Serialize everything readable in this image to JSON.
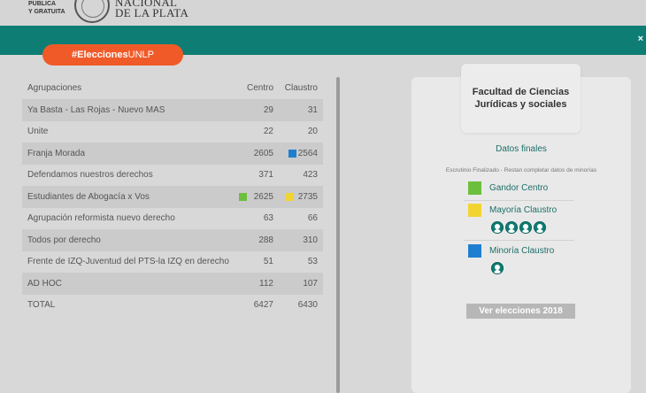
{
  "header": {
    "small_line1": "PÚBLICA",
    "small_line2": "Y GRATUITA",
    "name_line1": "NACIONAL",
    "name_line2": "DE LA PLATA"
  },
  "pill": {
    "hash": "#Elecciones",
    "suffix": "UNLP"
  },
  "table": {
    "headers": {
      "name": "Agrupaciones",
      "centro": "Centro",
      "claustro": "Claustro"
    },
    "rows": [
      {
        "name": "Ya Basta - Las Rojas - Nuevo MAS",
        "centro": "29",
        "claustro": "31"
      },
      {
        "name": "Unite",
        "centro": "22",
        "claustro": "20"
      },
      {
        "name": "Franja Morada",
        "centro": "2605",
        "claustro": "2564"
      },
      {
        "name": "Defendamos nuestros derechos",
        "centro": "371",
        "claustro": "423"
      },
      {
        "name": "Estudiantes de Abogacía x Vos",
        "centro": "2625",
        "claustro": "2735"
      },
      {
        "name": "Agrupación reformista nuevo derecho",
        "centro": "63",
        "claustro": "66"
      },
      {
        "name": "Todos por derecho",
        "centro": "288",
        "claustro": "310"
      },
      {
        "name": "Frente de IZQ-Juventud del PTS-la IZQ en derecho",
        "centro": "51",
        "claustro": "53"
      },
      {
        "name": "AD HOC",
        "centro": "112",
        "claustro": "107"
      },
      {
        "name": "TOTAL",
        "centro": "6427",
        "claustro": "6430"
      }
    ]
  },
  "card": {
    "faculty": "Facultad de Ciencias Jurídicas y sociales",
    "datos": "Datos finales",
    "escrutinio": "Escrutinio Finalizado - Restan completar datos de minorías",
    "ganador": "Gandor Centro",
    "mayoria": "Mayoría Claustro",
    "minoria": "Minoría Claustro",
    "button": "Ver elecciones 2018"
  },
  "colors": {
    "teal": "#0e7d73",
    "orange": "#f05a28",
    "green": "#6cbf3c",
    "yellow": "#f2d431",
    "blue": "#1e7fd0"
  }
}
